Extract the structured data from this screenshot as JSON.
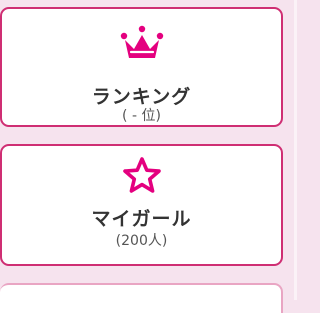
{
  "colors": {
    "background": "#f6e3ee",
    "accent": "#e4007f",
    "border": "#cf2e73",
    "text": "#333333"
  },
  "menu": {
    "ranking": {
      "icon": "crown-icon",
      "title": "ランキング",
      "subtitle": "( - 位)"
    },
    "my_girl": {
      "icon": "star-icon",
      "title": "マイガール",
      "subtitle": "(200人)"
    }
  }
}
